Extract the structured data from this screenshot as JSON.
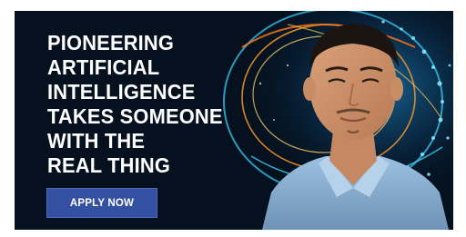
{
  "ad": {
    "headline_lines": [
      "PIONEERING",
      "ARTIFICIAL",
      "INTELLIGENCE",
      "TAKES SOMEONE",
      "WITH THE",
      "REAL THING"
    ],
    "cta_label": "APPLY NOW"
  },
  "colors": {
    "background": "#05111f",
    "headline_text": "#ffffff",
    "button_bg": "#3450a0",
    "glow_cyan": "#3fd4ff",
    "glow_orange": "#ff9a2e",
    "shirt": "#8fb4d6"
  }
}
